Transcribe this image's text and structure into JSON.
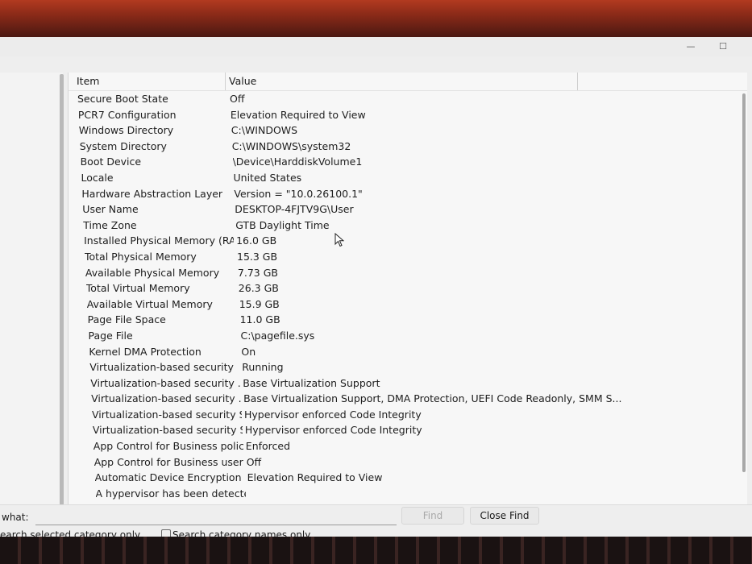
{
  "window": {
    "minimize_glyph": "—",
    "maximize_glyph": "☐"
  },
  "table": {
    "headers": {
      "item": "Item",
      "value": "Value"
    },
    "rows": [
      {
        "item": "Secure Boot State",
        "value": "Off"
      },
      {
        "item": "PCR7 Configuration",
        "value": "Elevation Required to View"
      },
      {
        "item": "Windows Directory",
        "value": "C:\\WINDOWS"
      },
      {
        "item": "System Directory",
        "value": "C:\\WINDOWS\\system32"
      },
      {
        "item": "Boot Device",
        "value": "\\Device\\HarddiskVolume1"
      },
      {
        "item": "Locale",
        "value": "United States"
      },
      {
        "item": "Hardware Abstraction Layer",
        "value": "Version = \"10.0.26100.1\""
      },
      {
        "item": "User Name",
        "value": "DESKTOP-4FJTV9G\\User"
      },
      {
        "item": "Time Zone",
        "value": "GTB Daylight Time"
      },
      {
        "item": "Installed Physical Memory (RA...",
        "value": "16.0 GB"
      },
      {
        "item": "Total Physical Memory",
        "value": "15.3 GB"
      },
      {
        "item": "Available Physical Memory",
        "value": "7.73 GB"
      },
      {
        "item": "Total Virtual Memory",
        "value": "26.3 GB"
      },
      {
        "item": "Available Virtual Memory",
        "value": "15.9 GB"
      },
      {
        "item": "Page File Space",
        "value": "11.0 GB"
      },
      {
        "item": "Page File",
        "value": "C:\\pagefile.sys"
      },
      {
        "item": "Kernel DMA Protection",
        "value": "On"
      },
      {
        "item": "Virtualization-based security",
        "value": "Running"
      },
      {
        "item": "Virtualization-based security ...",
        "value": "Base Virtualization Support"
      },
      {
        "item": "Virtualization-based security ...",
        "value": "Base Virtualization Support, DMA Protection, UEFI Code Readonly, SMM S..."
      },
      {
        "item": "Virtualization-based security S...",
        "value": "Hypervisor enforced Code Integrity"
      },
      {
        "item": "Virtualization-based security S...",
        "value": "Hypervisor enforced Code Integrity"
      },
      {
        "item": "App Control for Business policy",
        "value": "Enforced"
      },
      {
        "item": "App Control for Business user ...",
        "value": "Off"
      },
      {
        "item": "Automatic Device Encryption ...",
        "value": "Elevation Required to View"
      },
      {
        "item": "A hypervisor has been detecte...",
        "value": ""
      }
    ]
  },
  "find_bar": {
    "label": "what:",
    "input_value": "",
    "find_button": "Find",
    "close_find_button": "Close Find",
    "option_selected_category": "earch selected category only",
    "option_category_names": "Search category names only"
  }
}
